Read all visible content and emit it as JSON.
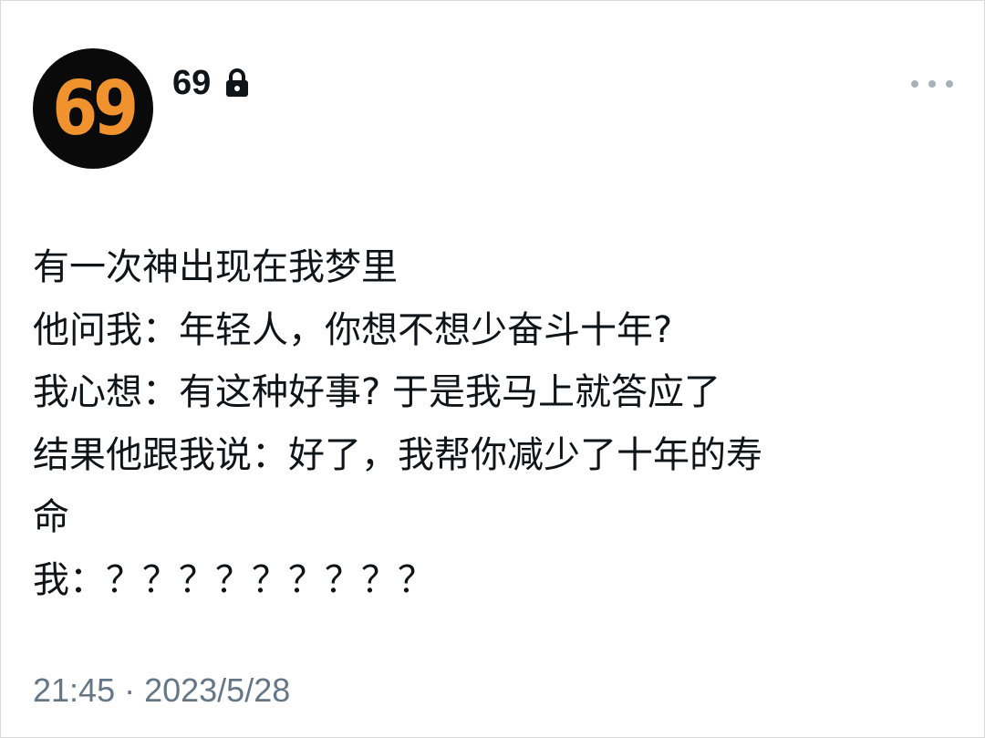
{
  "header": {
    "avatar_text": "69",
    "username": "69",
    "lock_icon": "lock-icon",
    "more_icon": "more-horizontal-icon",
    "accent_color": "#f0922e"
  },
  "tweet": {
    "lines": [
      "有一次神出现在我梦里",
      "他问我：年轻人，你想不想少奋斗十年?",
      "我心想：有这种好事? 于是我马上就答应了",
      "结果他跟我说：好了，我帮你减少了十年的寿",
      "命",
      "我：？？？？？？？？？"
    ]
  },
  "footer": {
    "timestamp": "21:45 · 2023/5/28"
  }
}
